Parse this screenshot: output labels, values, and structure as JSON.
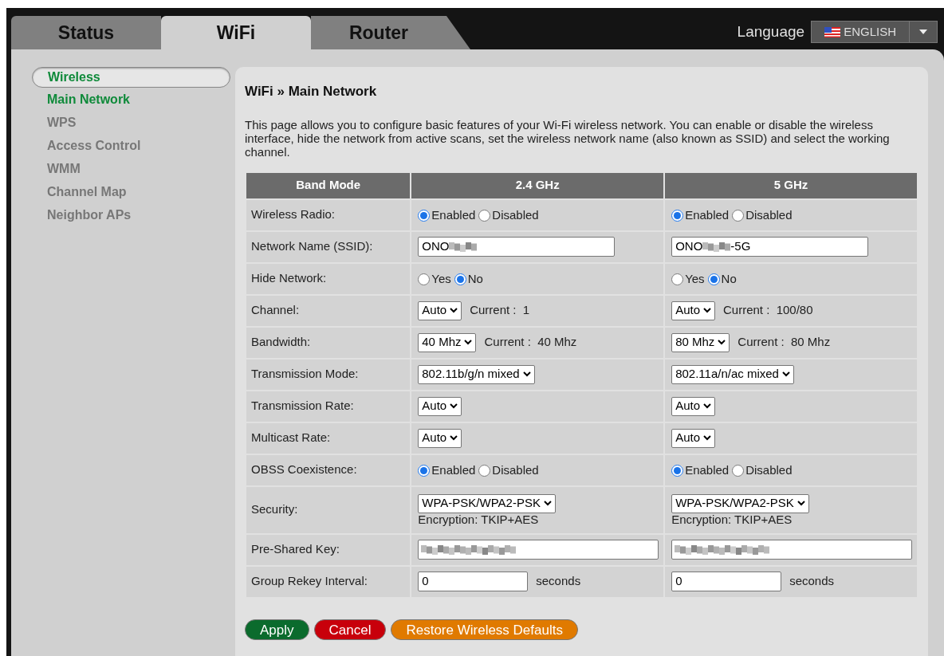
{
  "tabs": [
    {
      "label": "Status",
      "selected": false
    },
    {
      "label": "WiFi",
      "selected": true
    },
    {
      "label": "Router",
      "selected": false
    }
  ],
  "language": {
    "label": "Language",
    "value": "ENGLISH"
  },
  "sidebar": {
    "items": [
      {
        "label": "Wireless",
        "kind": "header",
        "selected": true
      },
      {
        "label": "Main Network",
        "kind": "item",
        "selected": true
      },
      {
        "label": "WPS",
        "kind": "item",
        "selected": false
      },
      {
        "label": "Access Control",
        "kind": "item",
        "selected": false
      },
      {
        "label": "WMM",
        "kind": "item",
        "selected": false
      },
      {
        "label": "Channel Map",
        "kind": "item",
        "selected": false
      },
      {
        "label": "Neighbor APs",
        "kind": "item",
        "selected": false
      }
    ]
  },
  "page": {
    "title": "WiFi » Main Network",
    "description": "This page allows you to configure basic features of your Wi-Fi wireless network. You can enable or disable the wireless interface, hide the network from active scans, set the wireless network name (also known as SSID) and select the working channel."
  },
  "table": {
    "columns": [
      "Band Mode",
      "2.4 GHz",
      "5 GHz"
    ],
    "rows": [
      {
        "kind": "radio",
        "cells": [
          {
            "text": "Wireless Radio:"
          },
          {
            "options": [
              {
                "label": "Enabled",
                "selected": true
              },
              {
                "label": "Disabled",
                "selected": false
              }
            ]
          },
          {
            "options": [
              {
                "label": "Enabled",
                "selected": true
              },
              {
                "label": "Disabled",
                "selected": false
              }
            ]
          }
        ]
      },
      {
        "kind": "text",
        "cells": [
          {
            "text": "Network Name (SSID):"
          },
          {
            "prefix": "ONO",
            "redacted": true
          },
          {
            "prefix": "ONO",
            "redacted": true,
            "suffix": "-5G"
          }
        ]
      },
      {
        "kind": "radio",
        "cells": [
          {
            "text": "Hide Network:"
          },
          {
            "options": [
              {
                "label": "Yes",
                "selected": false
              },
              {
                "label": "No",
                "selected": true
              }
            ]
          },
          {
            "options": [
              {
                "label": "Yes",
                "selected": false
              },
              {
                "label": "No",
                "selected": true
              }
            ]
          }
        ]
      },
      {
        "kind": "select",
        "cells": [
          {
            "text": "Channel:"
          },
          {
            "value": "Auto",
            "current": "Current :  1"
          },
          {
            "value": "Auto",
            "current": "Current :  100/80"
          }
        ]
      },
      {
        "kind": "select",
        "cells": [
          {
            "text": "Bandwidth:"
          },
          {
            "value": "40 Mhz",
            "current": "Current :  40 Mhz"
          },
          {
            "value": "80 Mhz",
            "current": "Current :  80 Mhz"
          }
        ]
      },
      {
        "kind": "select",
        "cells": [
          {
            "text": "Transmission Mode:"
          },
          {
            "value": "802.11b/g/n mixed"
          },
          {
            "value": "802.11a/n/ac mixed"
          }
        ]
      },
      {
        "kind": "select",
        "cells": [
          {
            "text": "Transmission Rate:"
          },
          {
            "value": "Auto"
          },
          {
            "value": "Auto"
          }
        ]
      },
      {
        "kind": "select",
        "cells": [
          {
            "text": "Multicast Rate:"
          },
          {
            "value": "Auto"
          },
          {
            "value": "Auto"
          }
        ]
      },
      {
        "kind": "radio",
        "cells": [
          {
            "text": "OBSS Coexistence:"
          },
          {
            "options": [
              {
                "label": "Enabled",
                "selected": true
              },
              {
                "label": "Disabled",
                "selected": false
              }
            ]
          },
          {
            "options": [
              {
                "label": "Enabled",
                "selected": true
              },
              {
                "label": "Disabled",
                "selected": false
              }
            ]
          }
        ]
      },
      {
        "kind": "security",
        "cells": [
          {
            "text": "Security:"
          },
          {
            "value": "WPA-PSK/WPA2-PSK",
            "encryption": "Encryption: TKIP+AES"
          },
          {
            "value": "WPA-PSK/WPA2-PSK",
            "encryption": "Encryption: TKIP+AES"
          }
        ]
      },
      {
        "kind": "key",
        "cells": [
          {
            "text": "Pre-Shared Key:"
          },
          {
            "redacted": true
          },
          {
            "redacted": true
          }
        ]
      },
      {
        "kind": "number",
        "cells": [
          {
            "text": "Group Rekey Interval:"
          },
          {
            "value": "0",
            "unit": "seconds"
          },
          {
            "value": "0",
            "unit": "seconds"
          }
        ]
      }
    ]
  },
  "buttons": [
    {
      "label": "Apply",
      "kind": "apply"
    },
    {
      "label": "Cancel",
      "kind": "cancel"
    },
    {
      "label": "Restore Wireless Defaults",
      "kind": "restore"
    }
  ]
}
